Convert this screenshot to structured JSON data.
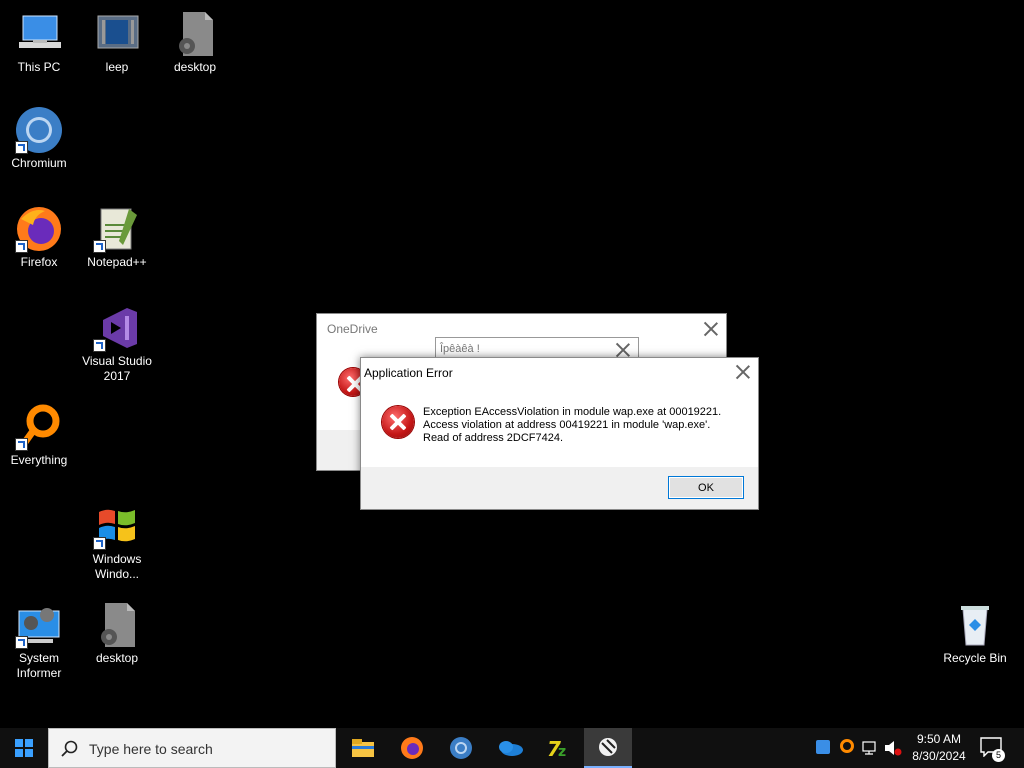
{
  "desktop": {
    "icons": [
      {
        "label": "This PC"
      },
      {
        "label": "leep"
      },
      {
        "label": "desktop"
      },
      {
        "label": "Chromium"
      },
      {
        "label": "Firefox"
      },
      {
        "label": "Notepad++"
      },
      {
        "label": "Visual Studio 2017"
      },
      {
        "label": "Everything"
      },
      {
        "label": "Windows Windo..."
      },
      {
        "label": "System Informer"
      },
      {
        "label": "desktop"
      },
      {
        "label": "Recycle Bin"
      }
    ]
  },
  "onedrive_dialog": {
    "title": "OneDrive",
    "inner_title": "Îpêàêà !"
  },
  "error_dialog": {
    "title": "Application Error",
    "line1": "Exception EAccessViolation in module wap.exe at 00019221.",
    "line2": "Access violation at address 00419221 in module 'wap.exe'.",
    "line3": "Read of address 2DCF7424.",
    "ok_label": "OK"
  },
  "taskbar": {
    "search_placeholder": "Type here to search",
    "time": "9:50 AM",
    "date": "8/30/2024",
    "notification_count": "5"
  },
  "colors": {
    "desktop_bg": "#000000",
    "taskbar_bg": "#101010",
    "error_red": "#c41616"
  }
}
